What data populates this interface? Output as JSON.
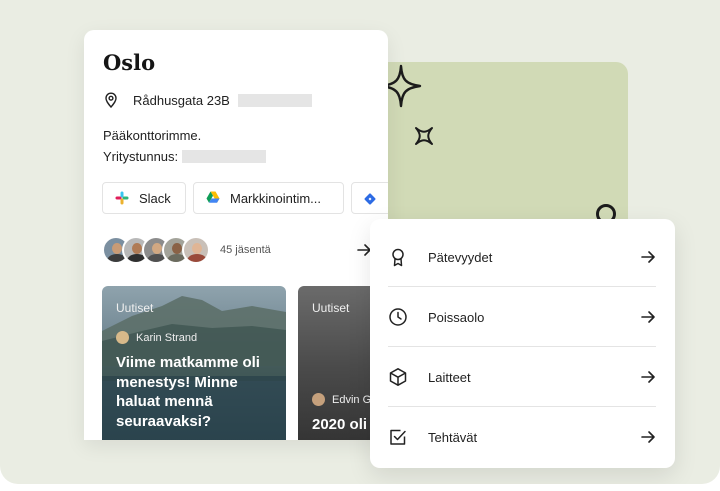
{
  "location": {
    "title": "Oslo",
    "address": "Rådhusgata 23B",
    "description": "Pääkonttorimme.",
    "company_id_label": "Yritystunnus:"
  },
  "channels": [
    {
      "label": "Slack",
      "icon": "slack-icon"
    },
    {
      "label": "Markkinointim...",
      "icon": "google-drive-icon"
    },
    {
      "label": "",
      "icon": "diamond-icon"
    }
  ],
  "members": {
    "count_label": "45 jäsentä"
  },
  "news": [
    {
      "tag": "Uutiset",
      "author": "Karin Strand",
      "headline": "Viime matkamme oli menestys! Minne haluat mennä seuraavaksi?"
    },
    {
      "tag": "Uutiset",
      "author": "Edvin G",
      "headline": "2020 oli"
    }
  ],
  "menu": [
    {
      "label": "Pätevyydet",
      "icon": "award-icon"
    },
    {
      "label": "Poissaolo",
      "icon": "clock-icon"
    },
    {
      "label": "Laitteet",
      "icon": "box-icon"
    },
    {
      "label": "Tehtävät",
      "icon": "checkbox-icon"
    }
  ],
  "colors": {
    "background": "#eaede3",
    "accent_block": "#d1dab6",
    "card": "#ffffff"
  }
}
